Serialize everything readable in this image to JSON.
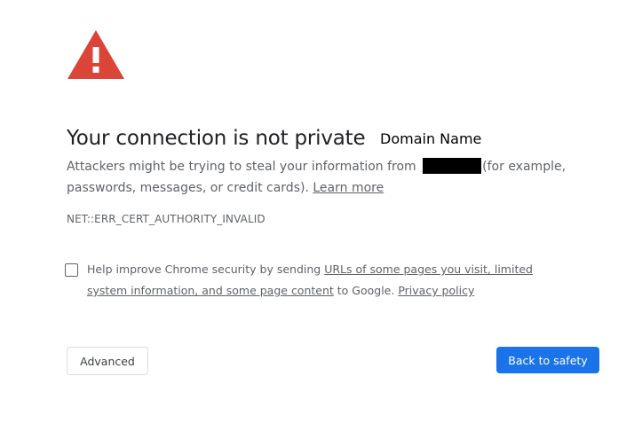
{
  "page": {
    "icon": "warning-triangle-icon",
    "title": "Your connection is not private",
    "annotation": "Domain Name",
    "message_before": "Attackers might be trying to steal your information from ",
    "message_after": "(for example, passwords, messages, or credit cards).",
    "learn_more_link": "Learn more",
    "error_code": "NET::ERR_CERT_AUTHORITY_INVALID"
  },
  "improve": {
    "checked": false,
    "text_before": "Help improve Chrome security by sending ",
    "link_urls": "URLs of some pages you visit, limited system information, and some page content",
    "text_middle": " to Google. ",
    "privacy_link": "Privacy policy"
  },
  "buttons": {
    "advanced_label": "Advanced",
    "back_label": "Back to safety"
  },
  "colors": {
    "warning_red": "#db4437",
    "primary_blue": "#1a73e8",
    "text_secondary": "#5f6368"
  }
}
